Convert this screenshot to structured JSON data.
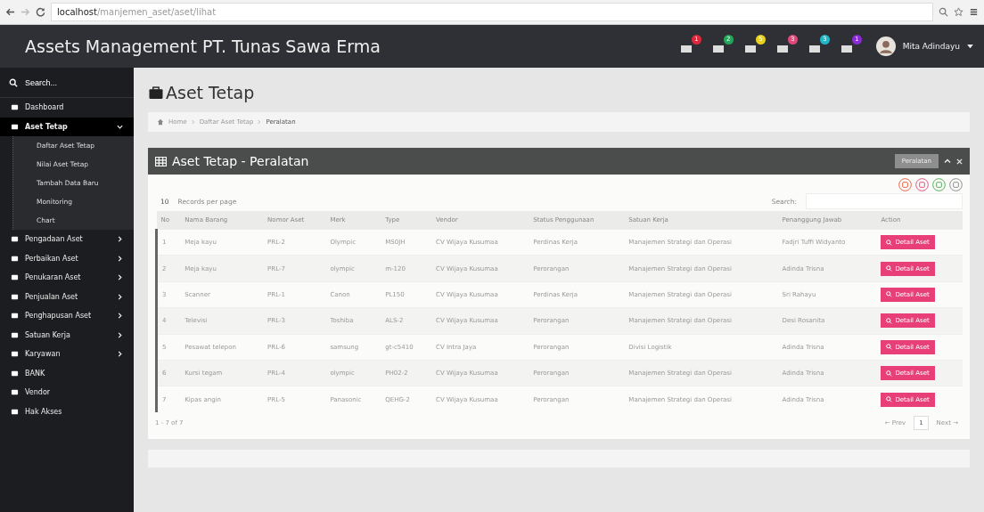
{
  "browser": {
    "url_host": "localhost",
    "url_path": "/manjemen_aset/aset/lihat"
  },
  "header": {
    "title": "Assets Management PT. Tunas Sawa Erma",
    "notifications": [
      {
        "count": "1",
        "color": "#e0283c"
      },
      {
        "count": "2",
        "color": "#22a85a"
      },
      {
        "count": "5",
        "color": "#e8d21c"
      },
      {
        "count": "3",
        "color": "#e0487c"
      },
      {
        "count": "3",
        "color": "#20b8c8"
      },
      {
        "count": "1",
        "color": "#8a2ad8"
      }
    ],
    "user": "Mita Adindayu"
  },
  "sidebar": {
    "search_placeholder": "Search...",
    "items": [
      {
        "label": "Dashboard",
        "has_arrow": false,
        "selected": false
      },
      {
        "label": "Aset Tetap",
        "expanded": true,
        "has_arrow": true,
        "selected": true,
        "children": [
          "Daftar Aset Tetap",
          "Nilai Aset Tetap",
          "Tambah Data Baru",
          "Monitoring",
          "Chart"
        ]
      },
      {
        "label": "Pengadaan Aset",
        "expanded": false,
        "has_arrow": true,
        "selected": false
      },
      {
        "label": "Perbaikan Aset",
        "expanded": false,
        "has_arrow": true,
        "selected": false
      },
      {
        "label": "Penukaran Aset",
        "expanded": false,
        "has_arrow": true,
        "selected": false
      },
      {
        "label": "Penjualan Aset",
        "expanded": false,
        "has_arrow": true,
        "selected": false
      },
      {
        "label": "Penghapusan Aset",
        "expanded": false,
        "has_arrow": true,
        "selected": false
      },
      {
        "label": "Satuan Kerja",
        "expanded": false,
        "has_arrow": true,
        "selected": false
      },
      {
        "label": "Karyawan",
        "expanded": false,
        "has_arrow": true,
        "selected": false
      },
      {
        "label": "BANK",
        "has_arrow": false,
        "selected": false
      },
      {
        "label": "Vendor",
        "has_arrow": false,
        "selected": false
      },
      {
        "label": "Hak Akses",
        "has_arrow": false,
        "selected": false
      }
    ]
  },
  "page_title": "Aset Tetap",
  "breadcrumb": [
    "Home",
    "Daftar Aset Tetap",
    "Peralatan"
  ],
  "panel": {
    "title": "Aset Tetap - Peralatan",
    "category": "Peralatan",
    "records_per_page": "10",
    "records_label": "Records per page",
    "search_label": "Search:",
    "table": {
      "columns": [
        "No",
        "Nama Barang",
        "Nomor Aset",
        "Merk",
        "Type",
        "Vendor",
        "Status Penggunaan",
        "Satuan Kerja",
        "Penanggung Jawab",
        "Action"
      ],
      "rows": [
        [
          "1",
          "Meja kayu",
          "PRL-2",
          "Olympic",
          "MS0JH",
          "CV Wijaya Kusumaa",
          "Perdinas Kerja",
          "Manajemen Strategi dan Operasi",
          "Fadjri Tuffi Widyanto",
          "Detail Aset"
        ],
        [
          "2",
          "Meja kayu",
          "PRL-7",
          "olympic",
          "m-120",
          "CV Wijaya Kusumaa",
          "Perorangan",
          "Manajemen Strategi dan Operasi",
          "Adinda Trisna",
          "Detail Aset"
        ],
        [
          "3",
          "Scanner",
          "PRL-1",
          "Canon",
          "PL150",
          "CV Wijaya Kusumaa",
          "Perdinas Kerja",
          "Manajemen Strategi dan Operasi",
          "Sri Rahayu",
          "Detail Aset"
        ],
        [
          "4",
          "Televisi",
          "PRL-3",
          "Toshiba",
          "ALS-2",
          "CV Wijaya Kusumaa",
          "Perorangan",
          "Manajemen Strategi dan Operasi",
          "Desi Rosanita",
          "Detail Aset"
        ],
        [
          "5",
          "Pesawat telepon",
          "PRL-6",
          "samsung",
          "gt-c5410",
          "CV Intra Jaya",
          "Perorangan",
          "Divisi Logistik",
          "Adinda Trisna",
          "Detail Aset"
        ],
        [
          "6",
          "Kursi tegam",
          "PRL-4",
          "olympic",
          "PH02-2",
          "CV Wijaya Kusumaa",
          "Perorangan",
          "Manajemen Strategi dan Operasi",
          "Adinda Trisna",
          "Detail Aset"
        ],
        [
          "7",
          "Kipas angin",
          "PRL-5",
          "Panasonic",
          "QEHG-2",
          "CV Wijaya Kusumaa",
          "Perorangan",
          "Manajemen Strategi dan Operasi",
          "Adinda Trisna",
          "Detail Aset"
        ]
      ]
    },
    "summary": "1 - 7 of 7",
    "pagination": [
      {
        "label": "← Prev",
        "selected": false
      },
      {
        "label": "1",
        "selected": true
      },
      {
        "label": "Next →",
        "selected": false
      }
    ]
  }
}
